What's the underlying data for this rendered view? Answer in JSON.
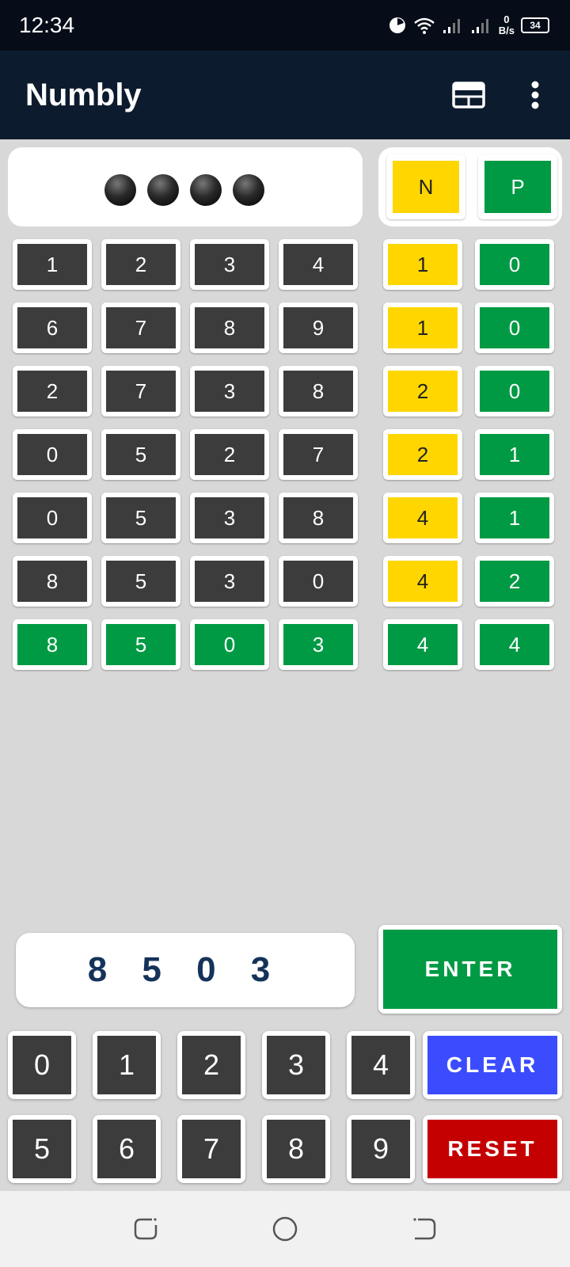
{
  "status_bar": {
    "time": "12:34",
    "net_speed_value": "0",
    "net_speed_unit": "B/s",
    "battery": "34"
  },
  "app_bar": {
    "title": "Numbly"
  },
  "legend": {
    "n_label": "N",
    "p_label": "P"
  },
  "guesses": [
    {
      "digits": [
        "1",
        "2",
        "3",
        "4"
      ],
      "n": "1",
      "p": "0",
      "solved": false
    },
    {
      "digits": [
        "6",
        "7",
        "8",
        "9"
      ],
      "n": "1",
      "p": "0",
      "solved": false
    },
    {
      "digits": [
        "2",
        "7",
        "3",
        "8"
      ],
      "n": "2",
      "p": "0",
      "solved": false
    },
    {
      "digits": [
        "0",
        "5",
        "2",
        "7"
      ],
      "n": "2",
      "p": "1",
      "solved": false
    },
    {
      "digits": [
        "0",
        "5",
        "3",
        "8"
      ],
      "n": "4",
      "p": "1",
      "solved": false
    },
    {
      "digits": [
        "8",
        "5",
        "3",
        "0"
      ],
      "n": "4",
      "p": "2",
      "solved": false
    },
    {
      "digits": [
        "8",
        "5",
        "0",
        "3"
      ],
      "n": "4",
      "p": "4",
      "solved": true
    }
  ],
  "entry": {
    "value": "8 5 0 3"
  },
  "buttons": {
    "enter": "ENTER",
    "clear": "CLEAR",
    "reset": "RESET"
  },
  "keypad": {
    "row1": [
      "0",
      "1",
      "2",
      "3",
      "4"
    ],
    "row2": [
      "5",
      "6",
      "7",
      "8",
      "9"
    ]
  },
  "colors": {
    "gray": "#3c3c3c",
    "green": "#019a44",
    "yellow": "#ffd600",
    "blue": "#3b4cff",
    "red": "#c40000",
    "app_bar": "#0d1b2e"
  }
}
